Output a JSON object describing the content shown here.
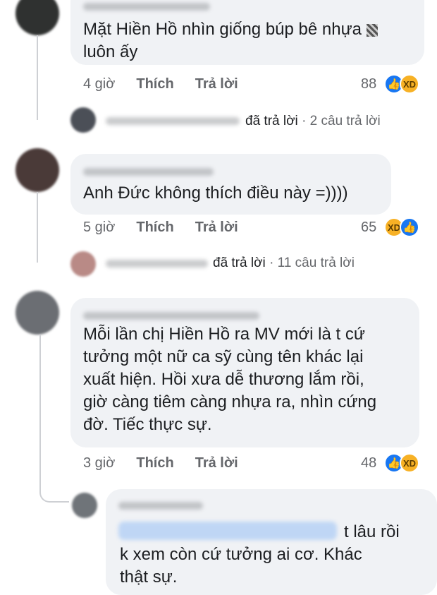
{
  "comments": [
    {
      "text_lines": [
        "Mặt Hiền Hồ nhìn giống búp bê nhựa",
        "luôn ấy"
      ],
      "time": "4 giờ",
      "like_label": "Thích",
      "reply_label": "Trả lời",
      "reaction_count": "88",
      "reactions": [
        "like-icon",
        "haha-icon"
      ],
      "replies_summary": {
        "action": "đã trả lời",
        "count_text": "· 2 câu trả lời"
      }
    },
    {
      "text_lines": [
        "Anh Đức không thích điều này =))))"
      ],
      "time": "5 giờ",
      "like_label": "Thích",
      "reply_label": "Trả lời",
      "reaction_count": "65",
      "reactions": [
        "haha-icon",
        "like-icon"
      ],
      "replies_summary": {
        "action": "đã trả lời",
        "count_text": "· 11 câu trả lời"
      }
    },
    {
      "text_lines": [
        "Mỗi lần chị Hiền Hồ ra MV mới là t cứ",
        "tưởng một nữ ca sỹ cùng tên khác lại",
        "xuất hiện. Hồi xưa dễ thương lắm rồi,",
        "giờ càng tiêm càng nhựa ra, nhìn cứng",
        "đờ. Tiếc thực sự."
      ],
      "time": "3 giờ",
      "like_label": "Thích",
      "reply_label": "Trả lời",
      "reaction_count": "48",
      "reactions": [
        "like-icon",
        "haha-icon"
      ]
    }
  ],
  "reply": {
    "text_lines": [
      "t lâu rồi",
      "k xem còn cứ tưởng ai cơ. Khác",
      "thật sự."
    ]
  },
  "colors": {
    "bubble": "#f0f2f5",
    "meta": "#65676b",
    "like": "#1877f2",
    "haha": "#f7b125"
  }
}
